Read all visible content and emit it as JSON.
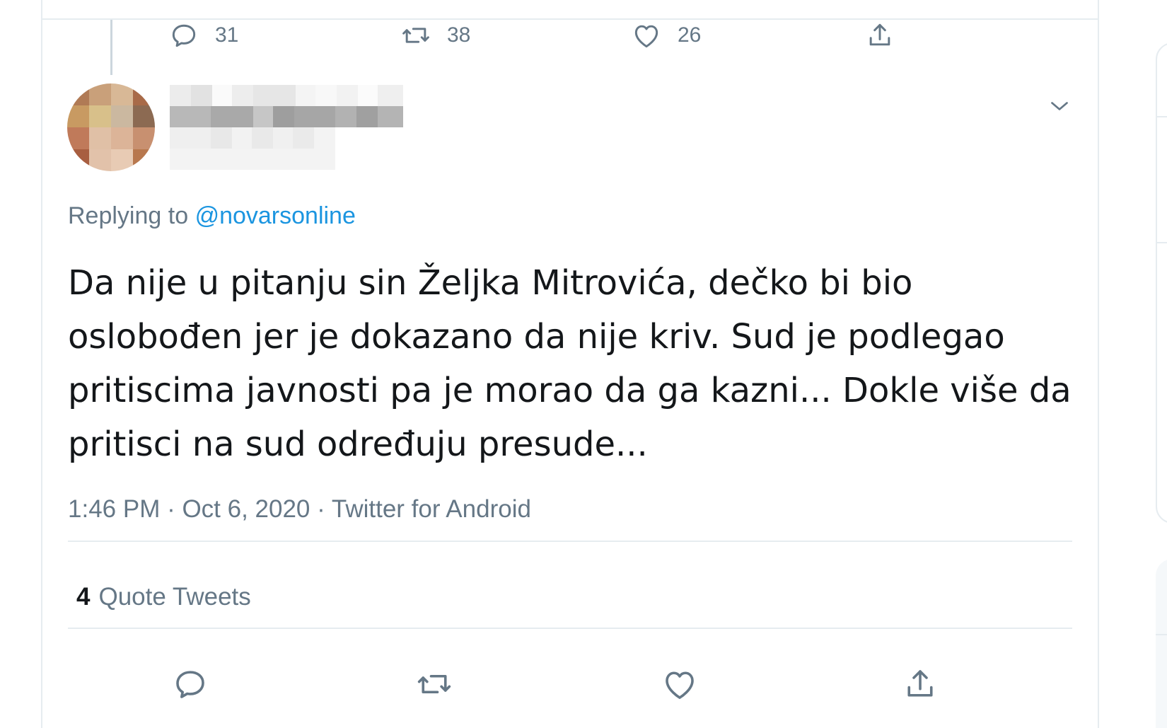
{
  "previous_tweet": {
    "reply_count": "31",
    "retweet_count": "38",
    "like_count": "26"
  },
  "tweet": {
    "replying_prefix": "Replying to",
    "replying_handle": "@novarsonline",
    "text": "Da nije u pitanju sin Željka Mitrovića, dečko bi bio oslobođen jer je dokazano da nije kriv. Sud je podlegao pritiscima javnosti pa je morao da ga kazni... Dokle više da pritisci na sud određuju presude...",
    "timestamp": "1:46 PM · Oct 6, 2020 · Twitter for Android",
    "quote_count": "4",
    "quote_label": "Quote Tweets"
  },
  "colors": {
    "accent": "#1b95e0",
    "muted_text": "#657786",
    "body_text": "#14171a",
    "border": "#e6ecf0"
  },
  "icons": {
    "reply": "reply-icon",
    "retweet": "retweet-icon",
    "like": "heart-icon",
    "share": "share-icon",
    "caret": "chevron-down-icon"
  }
}
